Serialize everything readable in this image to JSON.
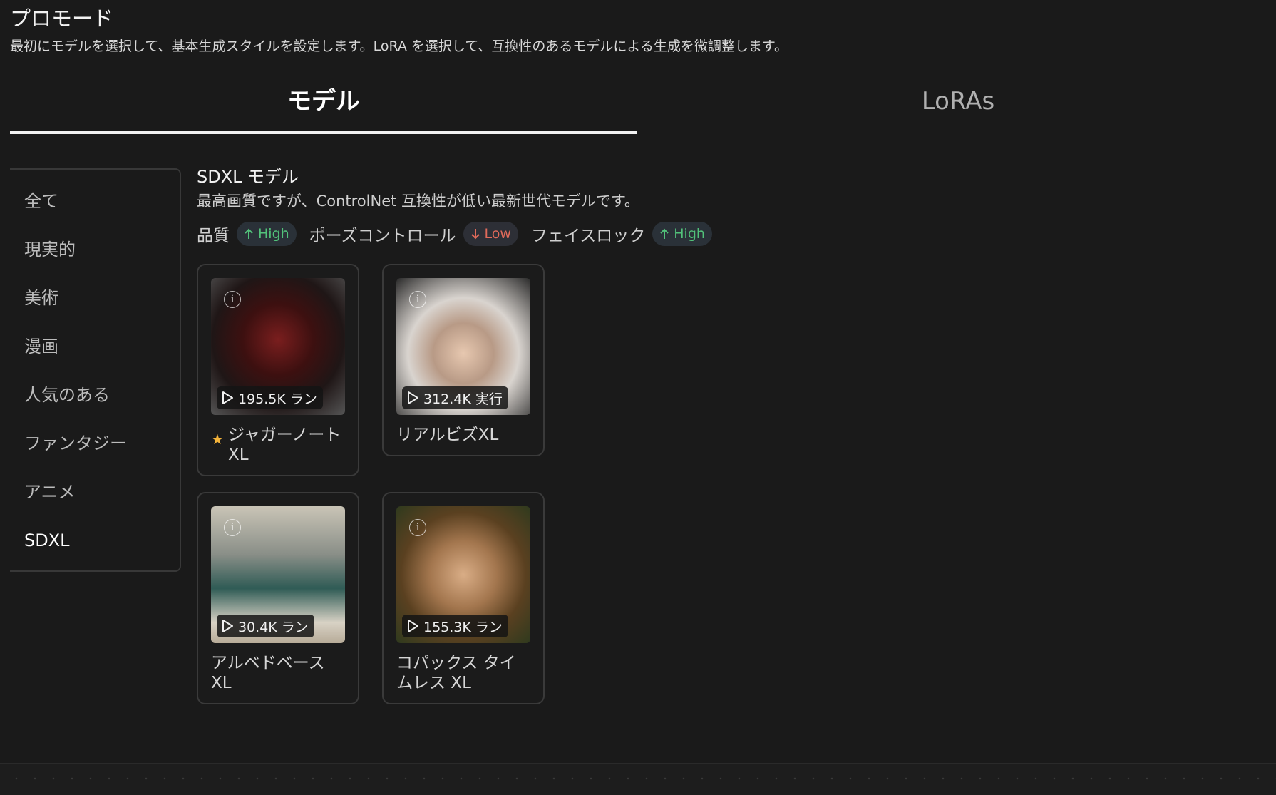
{
  "header": {
    "title": "プロモード",
    "description": "最初にモデルを選択して、基本生成スタイルを設定します。LoRA を選択して、互換性のあるモデルによる生成を微調整します。"
  },
  "tabs": [
    {
      "label": "モデル",
      "active": true
    },
    {
      "label": "LoRAs",
      "active": false
    }
  ],
  "sidebar": {
    "items": [
      {
        "label": "全て"
      },
      {
        "label": "現実的"
      },
      {
        "label": "美術"
      },
      {
        "label": "漫画"
      },
      {
        "label": "人気のある"
      },
      {
        "label": "ファンタジー"
      },
      {
        "label": "アニメ"
      },
      {
        "label": "SDXL",
        "active": true
      }
    ]
  },
  "section": {
    "title": "SDXL モデル",
    "description": "最高画質ですが、ControlNet 互換性が低い最新世代モデルです。",
    "attributes": [
      {
        "label": "品質",
        "level": "High",
        "direction": "up"
      },
      {
        "label": "ポーズコントロール",
        "level": "Low",
        "direction": "down"
      },
      {
        "label": "フェイスロック",
        "level": "High",
        "direction": "up"
      }
    ]
  },
  "models": [
    {
      "name": "ジャガーノートXL",
      "runs": "195.5K ラン",
      "starred": true,
      "info_icon": "info-icon"
    },
    {
      "name": "リアルビズXL",
      "runs": "312.4K 実行",
      "starred": false,
      "info_icon": "info-icon"
    },
    {
      "name": "アルベドベースXL",
      "runs": "30.4K ラン",
      "starred": false,
      "info_icon": "info-icon"
    },
    {
      "name": "コパックス タイムレス XL",
      "runs": "155.3K ラン",
      "starred": false,
      "info_icon": "info-icon"
    }
  ],
  "colors": {
    "background": "#1a1a1a",
    "up": "#52c27a",
    "down": "#e06a5a",
    "star": "#f5b43a"
  }
}
